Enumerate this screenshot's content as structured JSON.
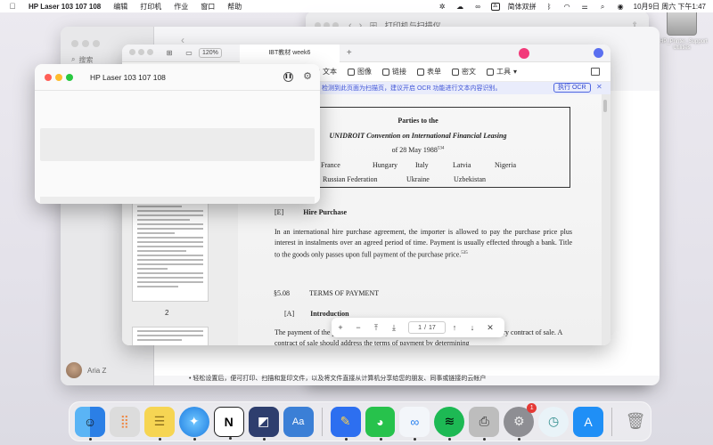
{
  "menubar": {
    "app_name": "HP Laser 103 107 108",
    "menus": [
      "编辑",
      "打印机",
      "作业",
      "窗口",
      "帮助"
    ],
    "input_method": "简体双拼",
    "clock": "10月9日 周六 下午1:47"
  },
  "desktop": {
    "drive_label": "HP_Printer_Support Utilities"
  },
  "finder_back": {
    "title": "打印机与扫描仪"
  },
  "queue_window": {
    "search_placeholder": "搜索",
    "user_name": "Aria Z",
    "hint": "• 轻松设置后，便可打印、扫描和复印文件，以及将文件直接从计算机分享给您的朋友、同事或链接的云帐户"
  },
  "pdf": {
    "zoom": "120%",
    "tab_title": "IBT教材 week6",
    "tools": [
      "文本",
      "图像",
      "链接",
      "表单",
      "密文",
      "工具"
    ],
    "ocr_message": "检测到此页面为扫描页，建议开启 OCR 功能进行文本内容识别。",
    "ocr_button": "执行 OCR",
    "thumb_page_label": "2",
    "current_page": "1",
    "total_pages": "17",
    "page": {
      "box_title1": "Parties to the",
      "box_title2": "UNIDROIT Convention on International Financial Leasing",
      "box_title3": "of 28 May 1988",
      "box_title3_sup": "534",
      "countries_row1": [
        "France",
        "Hungary",
        "Italy",
        "Latvia",
        "Nigeria"
      ],
      "countries_row2": [
        "Russian Federation",
        "Ukraine",
        "Uzbekistan"
      ],
      "sec_e_label": "[E]",
      "sec_e_title": "Hire Purchase",
      "para1": "In an international hire purchase agreement, the importer is allowed to pay the purchase price plus interest in instalments over an agreed period of time. Payment is usually effected through a bank. Title to the goods only passes upon full payment of the purchase price.",
      "para1_sup": "535",
      "sec508_label": "§5.08",
      "sec508_title": "TERMS OF PAYMENT",
      "secA_label": "[A]",
      "secA_title": "Introduction",
      "para2": "The payment of the purchase price is the main obligation of the buyer under every contract of sale. A contract of sale should address the terms of payment by determining"
    }
  },
  "hp_window": {
    "title": "HP Laser 103 107 108"
  },
  "dock": {
    "apps": [
      "Finder",
      "Launchpad",
      "Notes",
      "Safari",
      "Notion",
      "Microsoft Whiteboard",
      "Dictionary",
      "Pencil",
      "WeChat",
      "Baidu Netdisk",
      "Spotify",
      "Printer",
      "System Preferences",
      "Time Machine",
      "App Store",
      "Trash"
    ],
    "sysprefs_badge": "1"
  },
  "colors": {
    "close": "#ff5f57",
    "minimize": "#febc2e",
    "zoom": "#28c840",
    "ocr_accent": "#4156d8"
  }
}
